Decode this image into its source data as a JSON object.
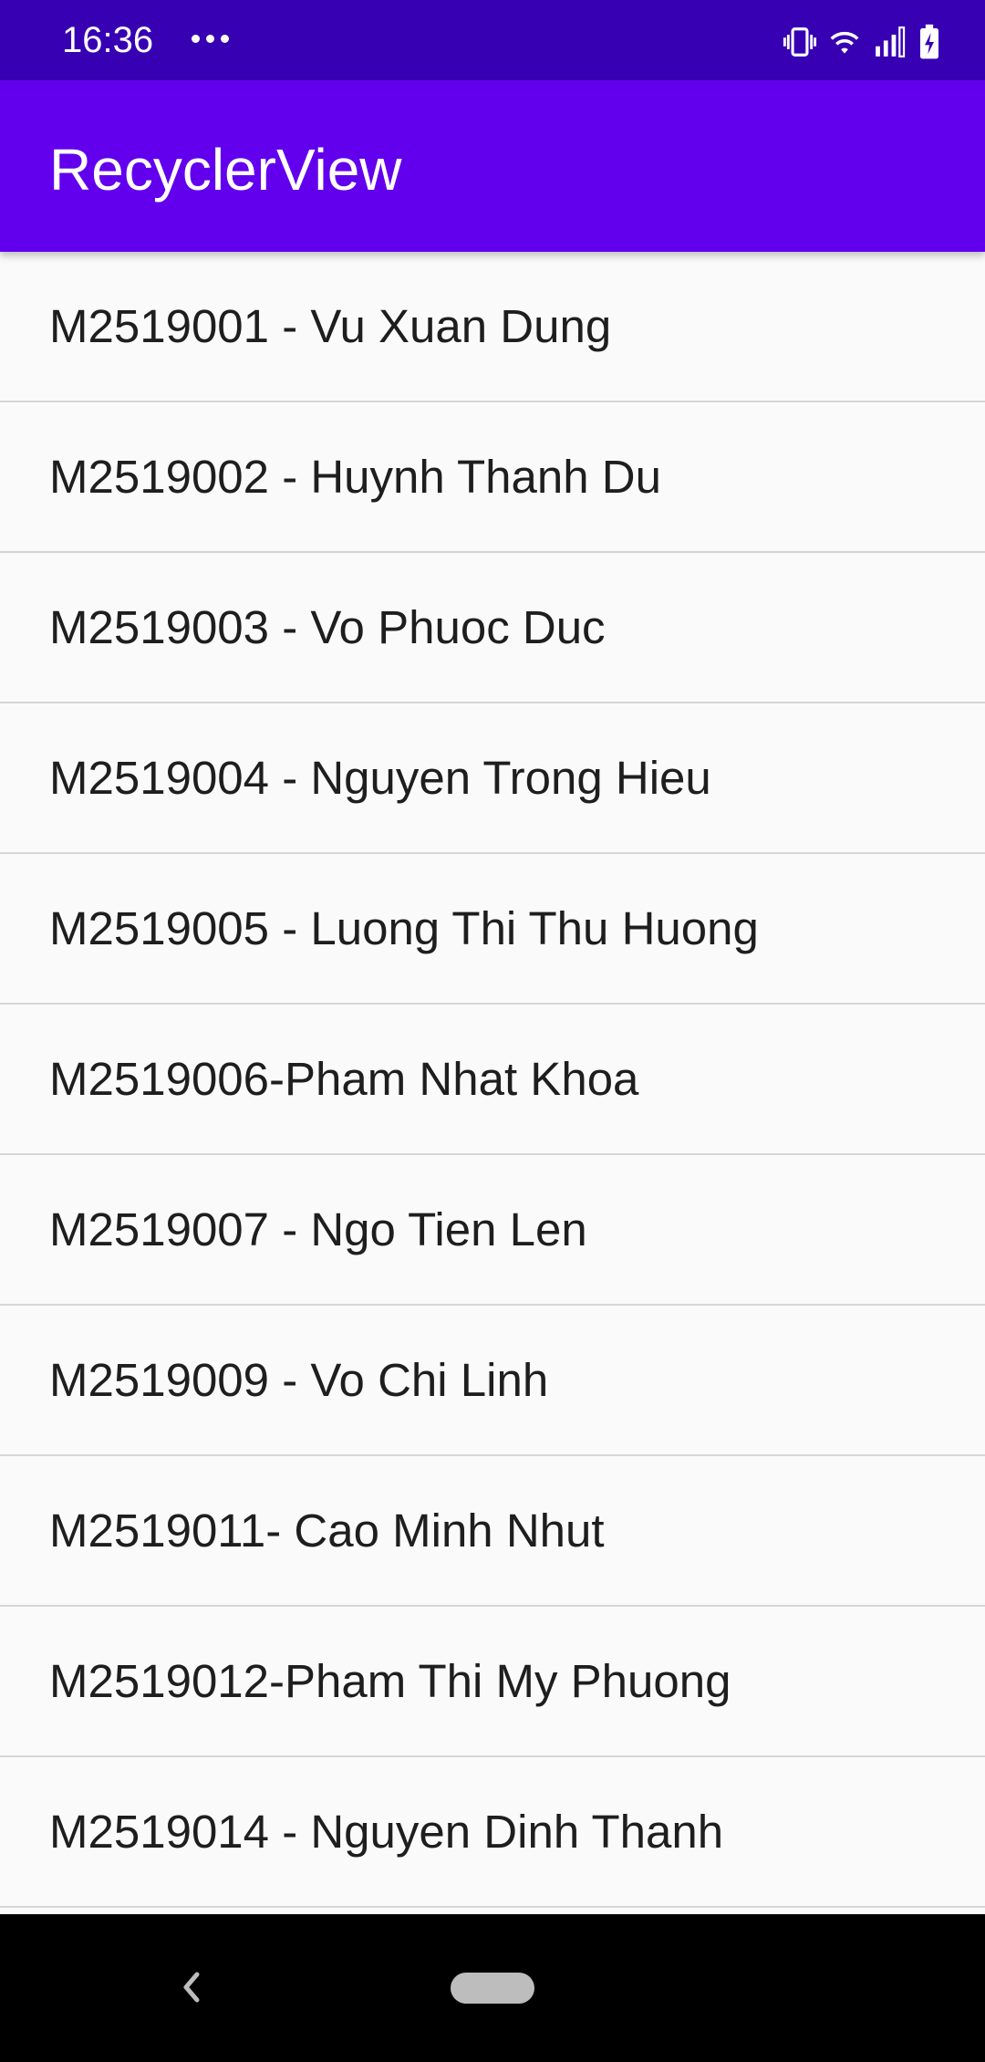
{
  "status_bar": {
    "time": "16:36",
    "overflow_icon": "more-dots-icon",
    "icons": [
      "vibrate-icon",
      "wifi-icon",
      "signal-icon",
      "battery-charging-icon"
    ]
  },
  "app_bar": {
    "title": "RecyclerView"
  },
  "list": {
    "items": [
      "M2519001 - Vu Xuan Dung",
      "M2519002 - Huynh Thanh Du",
      "M2519003 - Vo Phuoc Duc",
      "M2519004 - Nguyen Trong Hieu",
      "M2519005 - Luong Thi Thu Huong",
      "M2519006-Pham Nhat Khoa",
      "M2519007 - Ngo Tien Len",
      "M2519009 - Vo Chi Linh",
      "M2519011- Cao Minh Nhut",
      "M2519012-Pham Thi My Phuong",
      "M2519014 - Nguyen Dinh Thanh"
    ]
  },
  "nav_bar": {
    "back_icon": "back-chevron-icon",
    "home_icon": "home-pill-icon"
  },
  "colors": {
    "status_bar": "#3700b3",
    "app_bar": "#6200ee",
    "list_background": "#fafafa",
    "divider": "#d6d6d6",
    "nav_bar": "#000000"
  }
}
